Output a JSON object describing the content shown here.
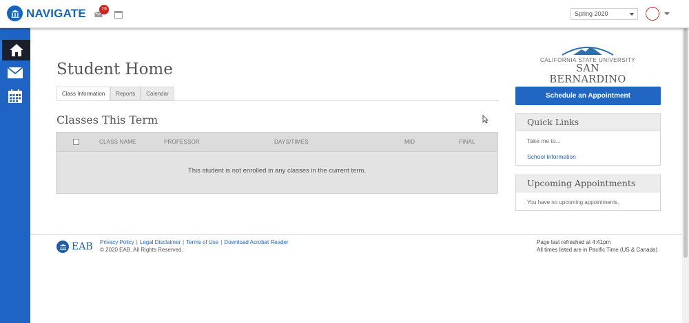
{
  "header": {
    "app_name": "NAVIGATE",
    "message_badge": "19",
    "term_selected": "Spring 2020"
  },
  "sidebar": {
    "items": [
      {
        "icon": "home-icon",
        "active": true
      },
      {
        "icon": "mail-icon",
        "active": false
      },
      {
        "icon": "calendar-icon",
        "active": false
      }
    ]
  },
  "main": {
    "page_title": "Student Home",
    "tabs": [
      {
        "label": "Class Information",
        "active": true
      },
      {
        "label": "Reports",
        "active": false
      },
      {
        "label": "Calendar",
        "active": false
      }
    ],
    "section_title": "Classes This Term",
    "table": {
      "columns": [
        "CLASS NAME",
        "PROFESSOR",
        "DAYS/TIMES",
        "MID",
        "FINAL"
      ],
      "empty_message": "This student is not enrolled in any classes in the current term."
    }
  },
  "right": {
    "university_line1": "CALIFORNIA STATE UNIVERSITY",
    "university_line2": "SAN BERNARDINO",
    "schedule_button": "Schedule an Appointment",
    "quick_links": {
      "title": "Quick Links",
      "take_me_to": "Take me to...",
      "link": "School Information"
    },
    "appointments": {
      "title": "Upcoming Appointments",
      "empty": "You have no upcoming appointments."
    }
  },
  "footer": {
    "brand": "EAB",
    "links": [
      "Privacy Policy",
      "Legal Disclaimer",
      "Terms of Use",
      "Download Acrobat Reader"
    ],
    "copyright": "© 2020 EAB. All Rights Reserved.",
    "refreshed": "Page last refreshed at 4:41pm",
    "timezone": "All times listed are in Pacific Time (US & Canada)"
  },
  "colors": {
    "brand_blue": "#1565c0",
    "sidebar_blue": "#1f64c4",
    "badge_red": "#d81e1e"
  }
}
